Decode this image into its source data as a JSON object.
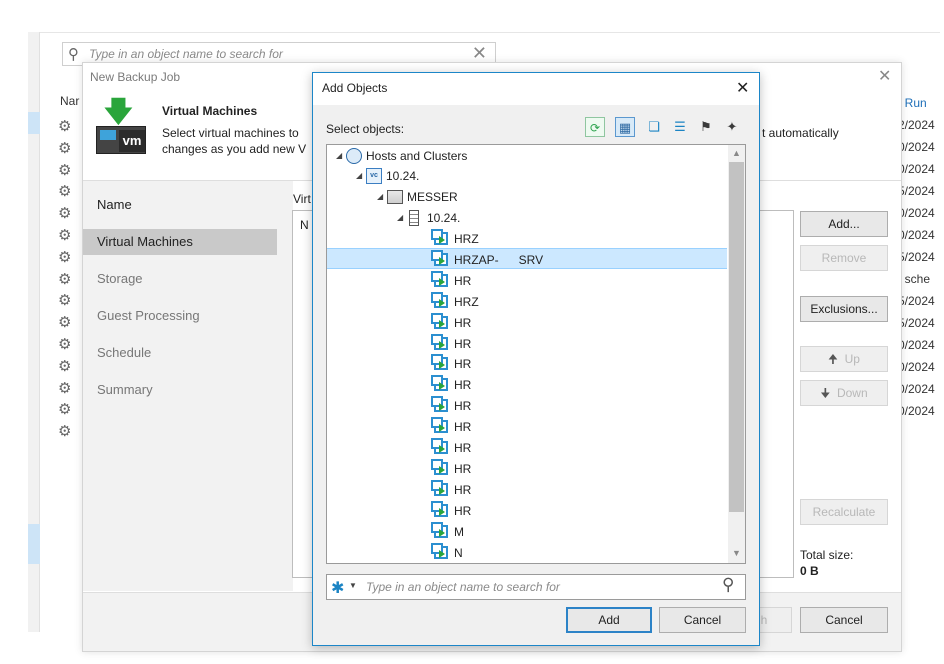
{
  "background": {
    "search_placeholder": "Type in an object name to search for",
    "name_col": "Nar",
    "gear_count": 15,
    "right_col": [
      {
        "text": "t Run",
        "link": true
      },
      {
        "text": "2/2024"
      },
      {
        "text": "0/2024"
      },
      {
        "text": "0/2024"
      },
      {
        "text": "5/2024"
      },
      {
        "text": "0/2024"
      },
      {
        "text": "0/2024"
      },
      {
        "text": "5/2024"
      },
      {
        "text": "t sche"
      },
      {
        "text": "5/2024"
      },
      {
        "text": "5/2024"
      },
      {
        "text": "0/2024"
      },
      {
        "text": "0/2024"
      },
      {
        "text": "0/2024"
      },
      {
        "text": "0/2024"
      }
    ]
  },
  "wizard": {
    "title": "New Backup Job",
    "header_title": "Virtual Machines",
    "header_desc_line1": "Select virtual machines to",
    "header_desc_line2": "changes as you add new V",
    "header_desc_right": "t automatically",
    "vm_tag": "vm",
    "steps": [
      "Name",
      "Virtual Machines",
      "Storage",
      "Guest Processing",
      "Schedule",
      "Summary"
    ],
    "list_label": "Virt",
    "list_col": "N",
    "buttons": {
      "add": "Add...",
      "remove": "Remove",
      "exclusions": "Exclusions...",
      "up": "Up",
      "down": "Down",
      "recalculate": "Recalculate"
    },
    "total_size_label": "Total size:",
    "total_size_value": "0 B",
    "finish": "h",
    "cancel": "Cancel"
  },
  "add_objects": {
    "title": "Add Objects",
    "select_label": "Select objects:",
    "tree": {
      "root": "Hosts and Clusters",
      "vcenter": "10.24.",
      "datacenter": "MESSER",
      "host": "10.24.",
      "vms": [
        "HRZ",
        "HRZAP-      SRV",
        "HR",
        "HRZ",
        "HR",
        "HR",
        "HR",
        "HR",
        "HR",
        "HR",
        "HR",
        "HR",
        "HR",
        "HR",
        "M",
        "N"
      ],
      "selected_index": 1
    },
    "search_placeholder": "Type in an object name to search for",
    "add_button": "Add",
    "cancel_button": "Cancel"
  }
}
